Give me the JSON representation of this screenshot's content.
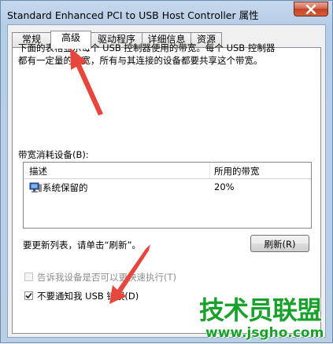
{
  "window": {
    "title": "Standard Enhanced PCI to USB Host Controller 属性",
    "close_glyph": "✕"
  },
  "tabs": [
    {
      "label": "常规",
      "active": false
    },
    {
      "label": "高级",
      "active": true
    },
    {
      "label": "驱动程序",
      "active": false
    },
    {
      "label": "详细信息",
      "active": false
    },
    {
      "label": "资源",
      "active": false
    }
  ],
  "advanced": {
    "description_line1": "下面的表格显示每个 USB 控制器使用的带宽。每个 USB 控制器",
    "description_line2": "都有一定量的带宽，所有与其连接的设备都要共享这个带宽。",
    "group_label": "带宽消耗设备(B):",
    "list": {
      "columns": [
        "描述",
        "所用的带宽"
      ],
      "rows": [
        {
          "description": "系统保留的",
          "bandwidth": "20%",
          "icon": "computer-icon"
        }
      ]
    },
    "refresh_text": "要更新列表，请单击“刷新”。",
    "refresh_button": "刷新(R)",
    "checkbox_faster": {
      "label": "告诉我设备是否可以更快速执行(T)",
      "checked": false,
      "enabled": false
    },
    "checkbox_errors": {
      "label": "不要通知我 USB 错误(D)",
      "checked": true,
      "enabled": true
    }
  },
  "watermark": {
    "title": "技术员联盟",
    "url": "www.jsgho.com"
  },
  "colors": {
    "arrow": "#e8463c",
    "watermark": "#1aa12c"
  }
}
